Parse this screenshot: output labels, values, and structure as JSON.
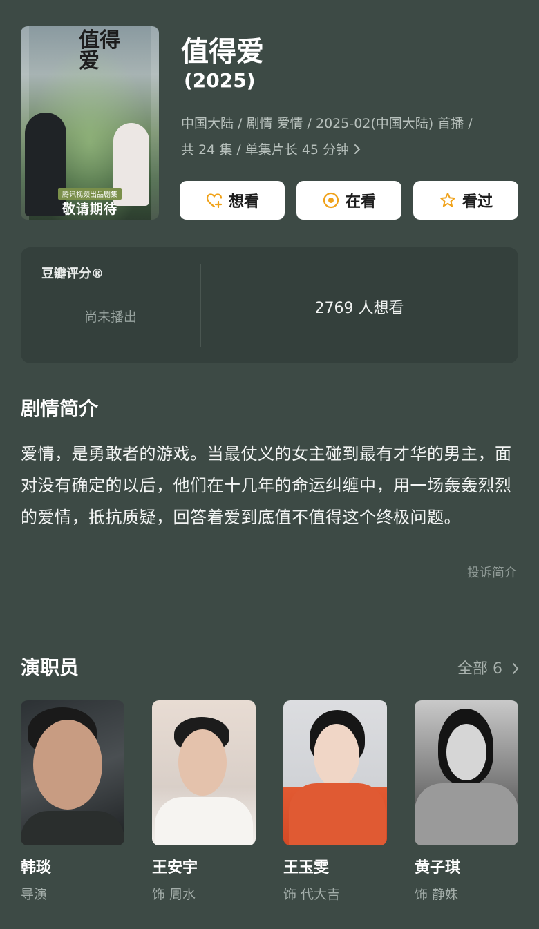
{
  "header": {
    "poster": {
      "title_art": "值得爱",
      "studio": "腾讯视频出品剧集",
      "tagline": "敬请期待"
    },
    "title": "值得爱",
    "year": "(2025)",
    "meta_line1": "中国大陆 / 剧情 爱情 / 2025-02(中国大陆) 首播 /",
    "meta_line2": "共 24 集 / 单集片长 45 分钟",
    "buttons": [
      {
        "label": "想看",
        "icon": "heart-plus-icon"
      },
      {
        "label": "在看",
        "icon": "target-circle-icon"
      },
      {
        "label": "看过",
        "icon": "star-outline-icon"
      }
    ],
    "accent_color": "#f0a21a"
  },
  "rating": {
    "label": "豆瓣评分®",
    "status": "尚未播出",
    "want_count": "2769 人想看"
  },
  "synopsis": {
    "title": "剧情简介",
    "text": "爱情，是勇敢者的游戏。当最仗义的女主碰到最有才华的男主，面对没有确定的以后，他们在十几年的命运纠缠中，用一场轰轰烈烈的爱情，抵抗质疑，回答着爱到底值不值得这个终极问题。",
    "report_label": "投诉简介"
  },
  "cast": {
    "title": "演职员",
    "all_label": "全部 6",
    "members": [
      {
        "name": "韩琰",
        "role": "导演"
      },
      {
        "name": "王安宇",
        "role": "饰 周水"
      },
      {
        "name": "王玉雯",
        "role": "饰 代大吉"
      },
      {
        "name": "黄子琪",
        "role": "饰 静姝"
      }
    ]
  }
}
